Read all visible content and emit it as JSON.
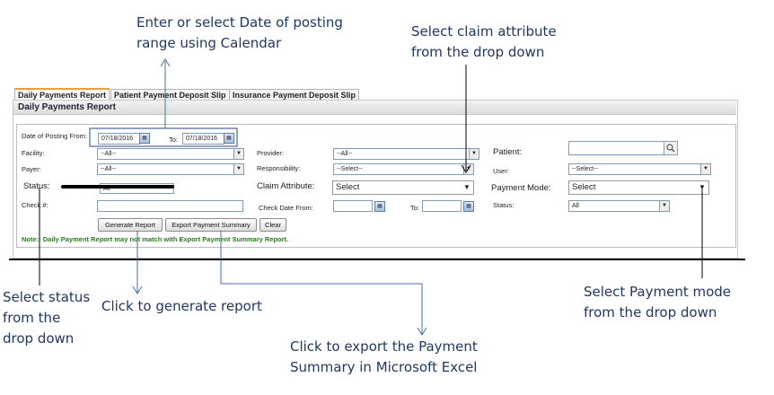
{
  "callouts": {
    "date_range": [
      "Enter or select  Date of posting",
      "range using Calendar"
    ],
    "claim_attribute": [
      "Select claim attribute",
      "from the drop down"
    ],
    "status": [
      "Select status",
      "from the",
      "drop down"
    ],
    "generate": "Click to generate report",
    "export": [
      "Click to export the Payment",
      "Summary in Microsoft Excel"
    ],
    "payment_mode": [
      "Select Payment mode",
      "from the drop down"
    ]
  },
  "tabs": [
    "Daily Payments Report",
    "Patient Payment Deposit Slip",
    "Insurance Payment Deposit Slip"
  ],
  "panel_title": "Daily Payments Report",
  "form": {
    "date_from_label": "Date of Posting From:",
    "date_from_value": "07/18/2016",
    "date_to_label": "To:",
    "date_to_value": "07/18/2016",
    "facility_label": "Facility:",
    "facility_value": "--All--",
    "provider_label": "Provider:",
    "provider_value": "--All--",
    "patient_label": "Patient:",
    "payer_label": "Payer:",
    "payer_value": "--All--",
    "responsibility_label": "Responsibility:",
    "responsibility_value": "--Select--",
    "user_label": "User:",
    "user_value": "--Select--",
    "status_label": "Status:",
    "status_value": "All",
    "claim_attribute_label": "Claim Attribute:",
    "claim_attribute_value": "Select",
    "payment_mode_label": "Payment Mode:",
    "payment_mode_value": "Select",
    "check_label": "Check #:",
    "check_date_from_label": "Check Date From:",
    "check_date_to_label": "To:",
    "status2_label": "Status:",
    "status2_value": "All"
  },
  "buttons": {
    "generate": "Generate Report",
    "export": "Export Payment Summary",
    "clear": "Clear"
  },
  "note": "Note:- Daily Payment Report may not match with Export Payment Summary Report.",
  "icons": {
    "calendar": "calendar-icon",
    "search": "search-icon",
    "dropdown": "chevron-down-icon"
  },
  "colors": {
    "callout_text": "#1f3864",
    "arrow_line": "#4a6fa5",
    "note_text": "#2b7a1c",
    "active_tab_border": "#e8a13a"
  }
}
